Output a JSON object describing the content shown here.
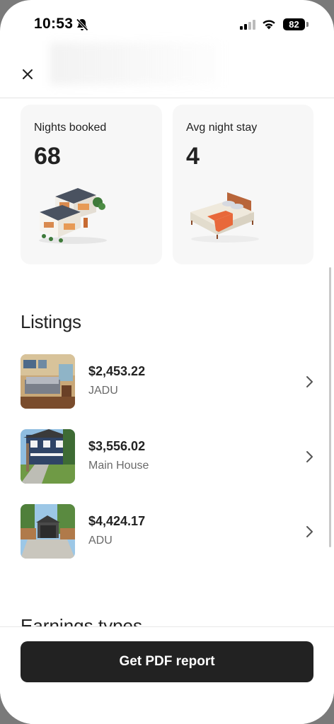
{
  "status_bar": {
    "time": "10:53",
    "battery": "82"
  },
  "stats": [
    {
      "label": "Nights booked",
      "value": "68"
    },
    {
      "label": "Avg night stay",
      "value": "4"
    }
  ],
  "listings_section": {
    "title": "Listings",
    "items": [
      {
        "price": "$2,453.22",
        "name": "JADU"
      },
      {
        "price": "$3,556.02",
        "name": "Main House"
      },
      {
        "price": "$4,424.17",
        "name": "ADU"
      }
    ]
  },
  "next_section": {
    "title": "Earnings types"
  },
  "footer": {
    "cta_label": "Get PDF report"
  },
  "icons": [
    "bell-off-icon",
    "signal-icon",
    "wifi-icon",
    "battery-icon",
    "close-icon",
    "chevron-right-icon"
  ],
  "colors": {
    "cta_bg": "#222222",
    "card_bg": "#f7f7f7",
    "bed_accent": "#e8683a"
  }
}
